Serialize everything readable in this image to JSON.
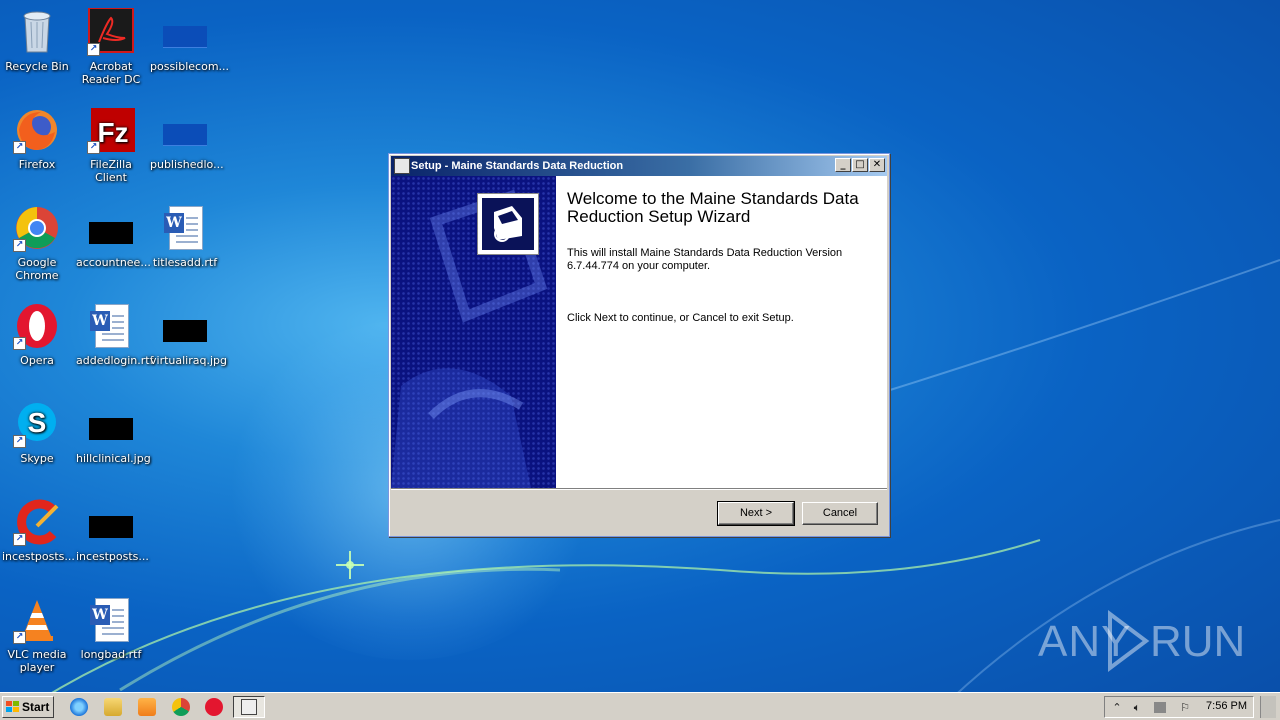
{
  "desktop": {
    "icons": [
      {
        "name": "recycle-bin",
        "label": "Recycle Bin"
      },
      {
        "name": "acrobat-reader",
        "label": "Acrobat Reader DC"
      },
      {
        "name": "possiblecom",
        "label": "possiblecom..."
      },
      {
        "name": "firefox",
        "label": "Firefox"
      },
      {
        "name": "filezilla",
        "label": "FileZilla Client"
      },
      {
        "name": "publishedlo",
        "label": "publishedlo..."
      },
      {
        "name": "google-chrome",
        "label": "Google Chrome"
      },
      {
        "name": "accountnee",
        "label": "accountnee..."
      },
      {
        "name": "titlesadd",
        "label": "titlesadd.rtf"
      },
      {
        "name": "opera",
        "label": "Opera"
      },
      {
        "name": "addedlogin",
        "label": "addedlogin.rtf"
      },
      {
        "name": "virtualiraq",
        "label": "virtualiraq.jpg"
      },
      {
        "name": "skype",
        "label": "Skype"
      },
      {
        "name": "hillclinical",
        "label": "hillclinical.jpg"
      },
      {
        "name": "ccleaner",
        "label": "CCleaner"
      },
      {
        "name": "incestposts",
        "label": "incestposts..."
      },
      {
        "name": "vlc",
        "label": "VLC media player"
      },
      {
        "name": "longbad",
        "label": "longbad.rtf"
      }
    ]
  },
  "window": {
    "title": "Setup - Maine Standards Data Reduction",
    "welcome_heading": "Welcome to the Maine Standards Data Reduction Setup Wizard",
    "install_text": "This will install Maine Standards Data Reduction Version 6.7.44.774 on your computer.",
    "continue_text": "Click Next to continue, or Cancel to exit Setup.",
    "next_label": "Next >",
    "cancel_label": "Cancel",
    "minimize_glyph": "_",
    "maximize_glyph": "□",
    "close_glyph": "✕"
  },
  "taskbar": {
    "start_label": "Start",
    "clock": "7:56 PM"
  },
  "watermark": {
    "left": "ANY",
    "right": "RUN"
  },
  "colors": {
    "titlebar_start": "#0a246a",
    "sidebar": "#0a1280",
    "desktop": "#0a63c4"
  }
}
